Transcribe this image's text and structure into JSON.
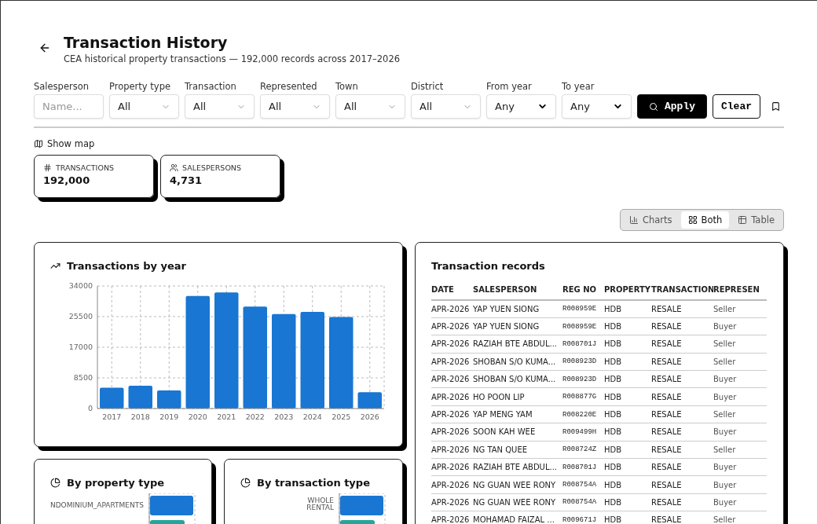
{
  "header": {
    "title": "Transaction History",
    "subtitle": "CEA historical property transactions — 192,000 records across 2017–2026"
  },
  "filters": [
    {
      "label": "Salesperson",
      "kind": "text",
      "placeholder": "Name..."
    },
    {
      "label": "Property type",
      "kind": "combo",
      "value": "All"
    },
    {
      "label": "Transaction",
      "kind": "combo",
      "value": "All"
    },
    {
      "label": "Represented",
      "kind": "combo",
      "value": "All"
    },
    {
      "label": "Town",
      "kind": "combo",
      "value": "All"
    },
    {
      "label": "District",
      "kind": "combo",
      "value": "All"
    },
    {
      "label": "From year",
      "kind": "select",
      "value": "Any"
    },
    {
      "label": "To year",
      "kind": "select",
      "value": "Any"
    }
  ],
  "actions": [
    {
      "label": "Apply",
      "kind": "primary"
    },
    {
      "label": "Clear",
      "kind": "secondary"
    }
  ],
  "show_map": "Show map",
  "stats": [
    {
      "label": "TRANSACTIONS",
      "value": "192,000"
    },
    {
      "label": "SALESPERSONS",
      "value": "4,731"
    }
  ],
  "view_modes": [
    {
      "label": "Charts",
      "selected": false
    },
    {
      "label": "Both",
      "selected": true
    },
    {
      "label": "Table",
      "selected": false
    }
  ],
  "year_chart": {
    "title": "Transactions by year",
    "chart_data": {
      "type": "bar",
      "categories": [
        "2017",
        "2018",
        "2019",
        "2020",
        "2021",
        "2022",
        "2023",
        "2024",
        "2025",
        "2026"
      ],
      "values": [
        5800,
        6300,
        5000,
        31200,
        32200,
        28300,
        26200,
        26800,
        25400,
        4500
      ],
      "ylim": [
        0,
        34000
      ],
      "yticks": [
        0,
        8500,
        17000,
        25500,
        34000
      ],
      "grid": true
    }
  },
  "side_charts": [
    {
      "title": "By property type",
      "labels": [
        "NDOMINIUM_APARTMENTS"
      ]
    },
    {
      "title": "By transaction type",
      "labels": [
        "WHOLE\nRENTAL"
      ]
    }
  ],
  "table": {
    "title": "Transaction records",
    "columns": [
      "DATE",
      "SALESPERSON",
      "REG NO",
      "PROPERTY",
      "TRANSACTION",
      "REPRESEN"
    ],
    "rows": [
      [
        "APR-2026",
        "YAP YUEN SIONG",
        "R008959E",
        "HDB",
        "RESALE",
        "Seller"
      ],
      [
        "APR-2026",
        "YAP YUEN SIONG",
        "R008959E",
        "HDB",
        "RESALE",
        "Buyer"
      ],
      [
        "APR-2026",
        "RAZIAH BTE ABDUL...",
        "R008701J",
        "HDB",
        "RESALE",
        "Seller"
      ],
      [
        "APR-2026",
        "SHOBAN S/O KUMA...",
        "R008923D",
        "HDB",
        "RESALE",
        "Seller"
      ],
      [
        "APR-2026",
        "SHOBAN S/O KUMA...",
        "R008923D",
        "HDB",
        "RESALE",
        "Buyer"
      ],
      [
        "APR-2026",
        "HO POON LIP",
        "R008877G",
        "HDB",
        "RESALE",
        "Buyer"
      ],
      [
        "APR-2026",
        "YAP MENG YAM",
        "R008220E",
        "HDB",
        "RESALE",
        "Seller"
      ],
      [
        "APR-2026",
        "SOON KAH WEE",
        "R009499H",
        "HDB",
        "RESALE",
        "Buyer"
      ],
      [
        "APR-2026",
        "NG TAN QUEE",
        "R008724Z",
        "HDB",
        "RESALE",
        "Seller"
      ],
      [
        "APR-2026",
        "RAZIAH BTE ABDUL...",
        "R008701J",
        "HDB",
        "RESALE",
        "Buyer"
      ],
      [
        "APR-2026",
        "NG GUAN WEE RONY",
        "R008754A",
        "HDB",
        "RESALE",
        "Buyer"
      ],
      [
        "APR-2026",
        "NG GUAN WEE RONY",
        "R008754A",
        "HDB",
        "RESALE",
        "Buyer"
      ],
      [
        "APR-2026",
        "MOHAMAD FAIZAL ...",
        "R009671J",
        "HDB",
        "RESALE",
        "Seller"
      ]
    ]
  }
}
